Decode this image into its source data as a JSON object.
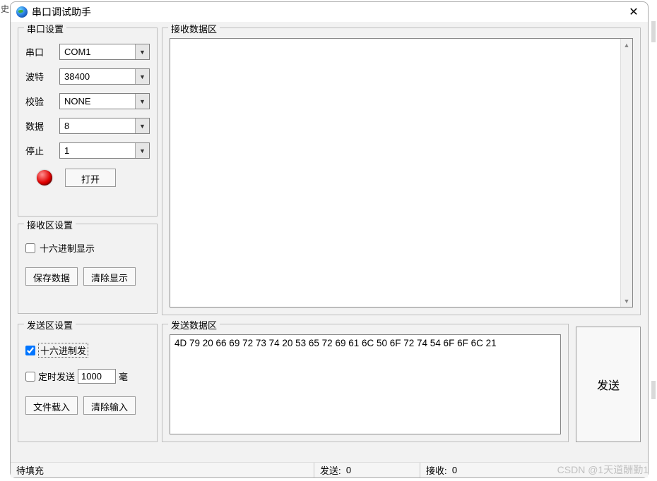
{
  "window": {
    "title": "串口调试助手"
  },
  "port_settings": {
    "legend": "串口设置",
    "port_label": "串口",
    "port_value": "COM1",
    "baud_label": "波特",
    "baud_value": "38400",
    "parity_label": "校验",
    "parity_value": "NONE",
    "data_label": "数据",
    "data_value": "8",
    "stop_label": "停止",
    "stop_value": "1",
    "open_button": "打开"
  },
  "recv_settings": {
    "legend": "接收区设置",
    "hex_display": "十六进制显示",
    "save_data": "保存数据",
    "clear_display": "清除显示"
  },
  "recv_area": {
    "legend": "接收数据区",
    "content": ""
  },
  "send_settings": {
    "legend": "发送区设置",
    "hex_send": "十六进制发",
    "hex_send_checked": true,
    "timed_send": "定时发送",
    "timed_interval": "1000",
    "timed_unit": "毫",
    "file_load": "文件载入",
    "clear_input": "清除输入"
  },
  "send_area": {
    "legend": "发送数据区",
    "content": "4D 79 20 66 69 72 73 74 20 53 65 72 69 61 6C 50 6F 72 74 54 6F 6F 6C 21"
  },
  "send_button": "发送",
  "statusbar": {
    "left": "待填充",
    "send_label": "发送:",
    "send_count": "0",
    "recv_label": "接收:",
    "recv_count": "0"
  },
  "watermark": "CSDN @1天道酬勤1",
  "left_edge_char": "史"
}
